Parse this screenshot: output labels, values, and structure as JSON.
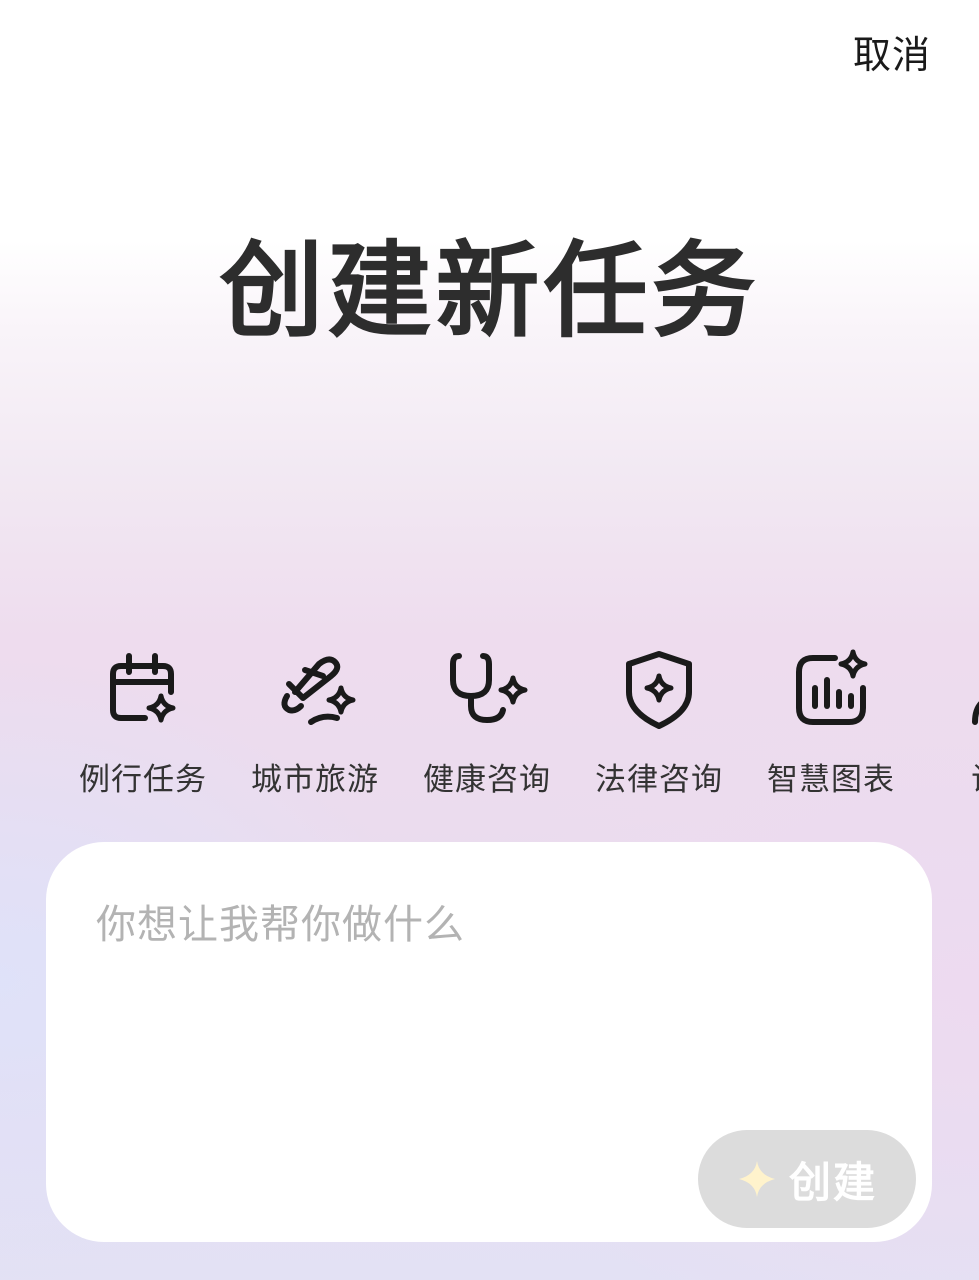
{
  "header": {
    "cancel_label": "取消"
  },
  "main": {
    "title": "创建新任务"
  },
  "categories": [
    {
      "label": "例行任务",
      "icon": "calendar-sparkle-icon"
    },
    {
      "label": "城市旅游",
      "icon": "plane-sparkle-icon"
    },
    {
      "label": "健康咨询",
      "icon": "stethoscope-sparkle-icon"
    },
    {
      "label": "法律咨询",
      "icon": "shield-sparkle-icon"
    },
    {
      "label": "智慧图表",
      "icon": "chart-sparkle-icon"
    },
    {
      "label": "试题",
      "icon": "person-icon"
    }
  ],
  "input": {
    "placeholder": "你想让我帮你做什么",
    "value": ""
  },
  "create_button": {
    "label": "创建",
    "icon": "sparkle-icon",
    "state": "disabled"
  },
  "colors": {
    "title_text": "#2d2d2d",
    "icon_stroke": "#1a1a1a",
    "placeholder": "#b3b3b3",
    "button_disabled_bg": "#dcdcdc",
    "button_sparkle": "#fff3cc"
  }
}
